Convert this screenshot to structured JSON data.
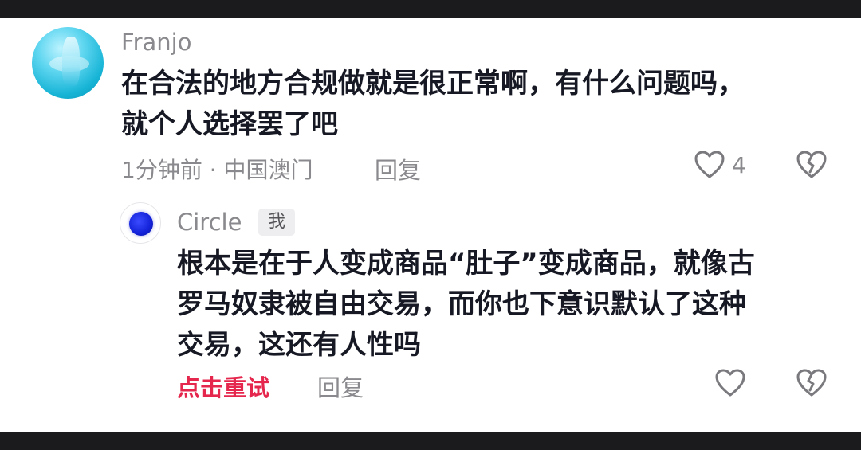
{
  "comments": [
    {
      "username": "Franjo",
      "text_line1": "在合法的地方合规做就是很正常啊，有什么问题吗，",
      "text_line2": "就个人选择罢了吧",
      "meta": "1分钟前 · 中国澳门",
      "reply_label": "回复",
      "like_count": "4"
    }
  ],
  "reply": {
    "username": "Circle",
    "badge": "我",
    "text_line1": "根本是在于人变成商品“肚子”变成商品，就像古",
    "text_line2": "罗马奴隶被自由交易，而你也下意识默认了这种",
    "text_line3": "交易，这还有人性吗",
    "retry_label": "点击重试",
    "reply_label": "回复"
  },
  "icons": [
    "heart-outline-icon",
    "broken-heart-icon"
  ],
  "colors": {
    "text": "#161823",
    "meta": "#8a8a8e",
    "retry": "#e5264d",
    "background": "#ffffff"
  }
}
